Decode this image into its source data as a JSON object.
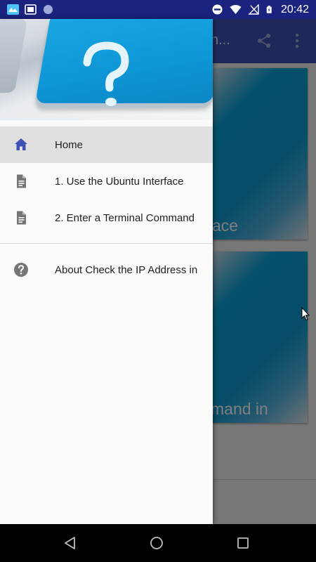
{
  "status_bar": {
    "time": "20:42",
    "left_icons": [
      "app-icon",
      "screenshot-icon",
      "circle-icon"
    ],
    "right_icons": [
      "do-not-disturb-icon",
      "wifi-icon",
      "no-signal-icon",
      "battery-icon"
    ]
  },
  "app_bar": {
    "title_fragment": "n...",
    "share_icon": "share-icon",
    "more_icon": "more-vert-icon",
    "color": "#3f51b5"
  },
  "cards": [
    {
      "title_fragment": "ace"
    },
    {
      "title_fragment": "mand in"
    }
  ],
  "drawer": {
    "items": [
      {
        "label": "Home",
        "icon": "home-icon",
        "selected": true
      },
      {
        "label": "1. Use the Ubuntu Interface",
        "icon": "document-icon",
        "selected": false
      },
      {
        "label": "2. Enter a Terminal Command",
        "icon": "document-icon",
        "selected": false
      }
    ],
    "secondary_items": [
      {
        "label": "About Check the IP Address in",
        "icon": "help-icon"
      }
    ],
    "accent_color": "#3f51b5"
  },
  "nav_bar": {
    "back_icon": "back-icon",
    "home_icon": "home-circle-icon",
    "recents_icon": "recents-icon"
  }
}
